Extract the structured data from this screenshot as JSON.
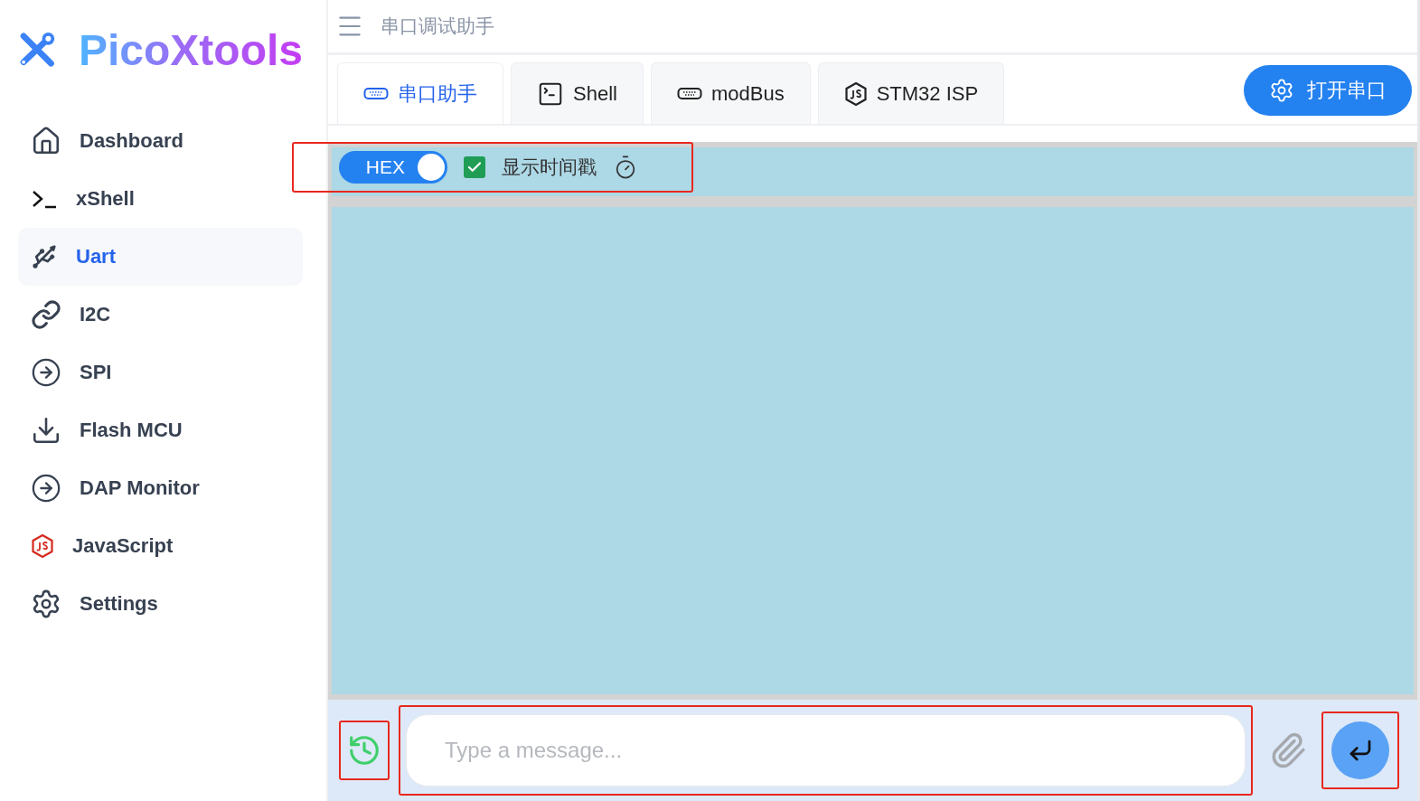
{
  "logo": {
    "text": "PicoXtools"
  },
  "sidebar": {
    "items": [
      {
        "label": "Dashboard",
        "kind": "home",
        "selected": false
      },
      {
        "label": "xShell",
        "kind": "prompt",
        "selected": false
      },
      {
        "label": "Uart",
        "kind": "usb",
        "selected": true
      },
      {
        "label": "I2C",
        "kind": "link",
        "selected": false
      },
      {
        "label": "SPI",
        "kind": "arrow",
        "selected": false
      },
      {
        "label": "Flash MCU",
        "kind": "download",
        "selected": false
      },
      {
        "label": "DAP Monitor",
        "kind": "arrow",
        "selected": false
      },
      {
        "label": "JavaScript",
        "kind": "js",
        "selected": false
      },
      {
        "label": "Settings",
        "kind": "gear",
        "selected": false
      }
    ]
  },
  "header": {
    "title": "串口调试助手"
  },
  "tabs": [
    {
      "label": "串口助手",
      "kind": "port",
      "selected": true
    },
    {
      "label": "Shell",
      "kind": "terminal",
      "selected": false
    },
    {
      "label": "modBus",
      "kind": "port",
      "selected": false
    },
    {
      "label": "STM32 ISP",
      "kind": "js",
      "selected": false
    }
  ],
  "open_button": {
    "label": "打开串口"
  },
  "toolbar": {
    "hex_toggle": {
      "label": "HEX",
      "on": true
    },
    "timestamp": {
      "label": "显示时间戳",
      "checked": true
    }
  },
  "composer": {
    "placeholder": "Type a message..."
  }
}
